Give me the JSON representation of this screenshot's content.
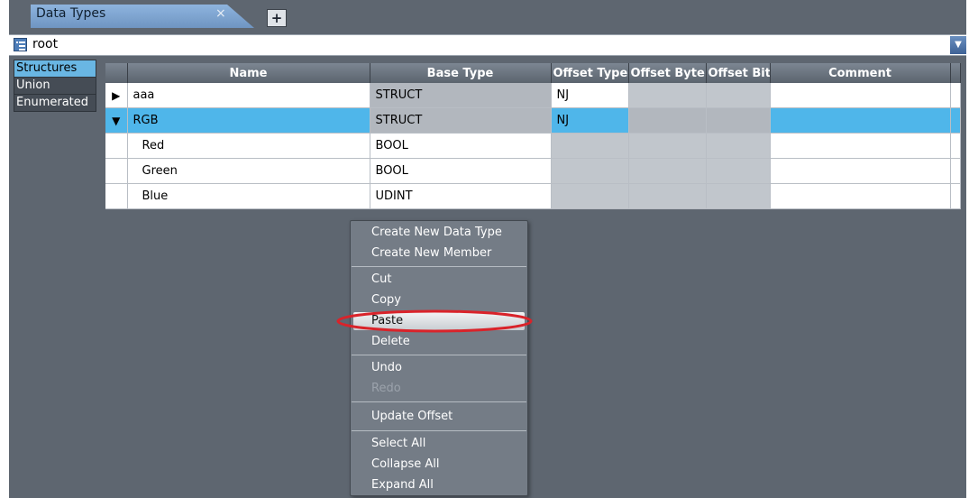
{
  "tab": {
    "title": "Data Types",
    "close": "×",
    "add": "+"
  },
  "path": {
    "text": "root",
    "dropdown_icon": "▼"
  },
  "categories": [
    "Structures",
    "Union",
    "Enumerated"
  ],
  "table": {
    "headers": [
      "Name",
      "Base Type",
      "Offset Type",
      "Offset Byte",
      "Offset Bit",
      "Comment"
    ],
    "rows": [
      {
        "expander": "▶",
        "name": "aaa",
        "base_type": "STRUCT",
        "offset_type": "NJ"
      },
      {
        "expander": "▼",
        "name": "RGB",
        "base_type": "STRUCT",
        "offset_type": "NJ"
      },
      {
        "expander": "",
        "name": "Red",
        "base_type": "BOOL",
        "offset_type": ""
      },
      {
        "expander": "",
        "name": "Green",
        "base_type": "BOOL",
        "offset_type": ""
      },
      {
        "expander": "",
        "name": "Blue",
        "base_type": "UDINT",
        "offset_type": ""
      }
    ]
  },
  "context_menu": {
    "create_new_data_type": "Create New Data Type",
    "create_new_member": "Create New Member",
    "cut": "Cut",
    "copy": "Copy",
    "paste": "Paste",
    "delete": "Delete",
    "undo": "Undo",
    "redo": "Redo",
    "update_offset": "Update Offset",
    "select_all": "Select All",
    "collapse_all": "Collapse All",
    "expand_all": "Expand All"
  },
  "colors": {
    "selection": "#4fb6ea",
    "highlight_ring": "#d9232a",
    "panel": "#5e6670"
  }
}
